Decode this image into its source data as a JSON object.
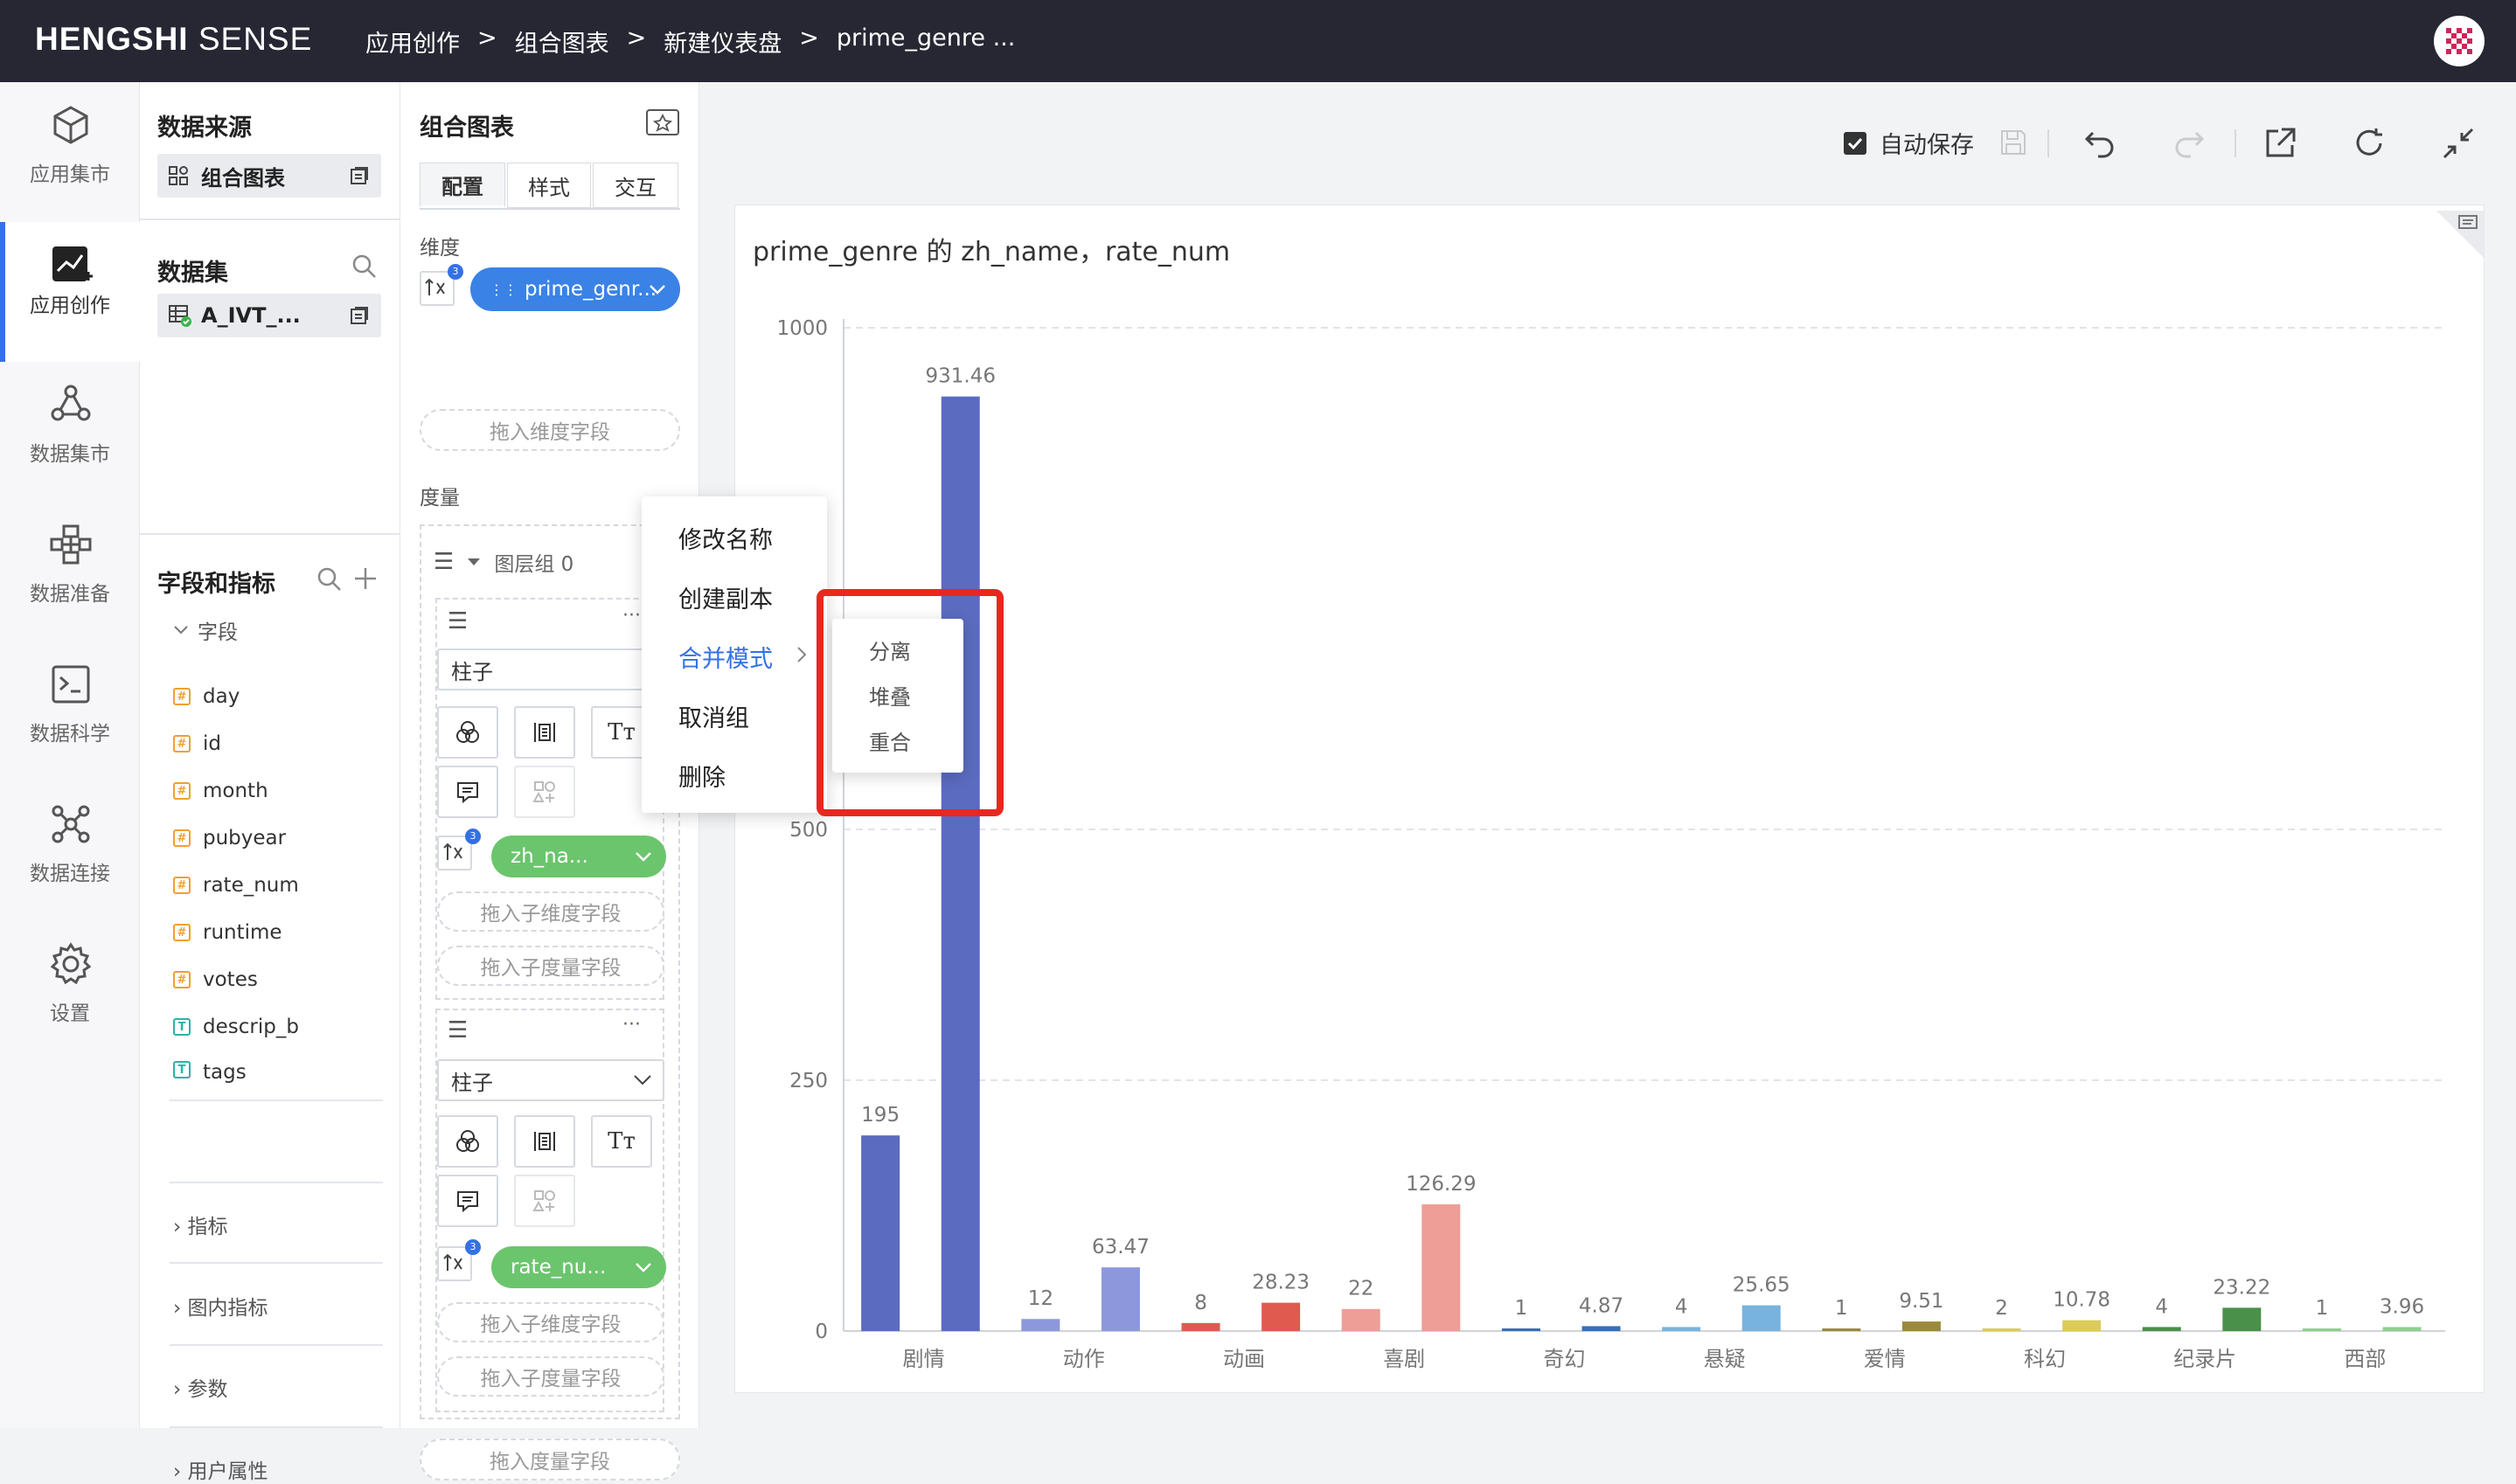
{
  "app": {
    "logo_bold": "HENGSHI",
    "logo_light": " SENSE",
    "breadcrumb": [
      "应用创作",
      "组合图表",
      "新建仪表盘",
      "prime_genre ..."
    ],
    "breadcrumb_sep": ">"
  },
  "nav": {
    "items": [
      {
        "label": "应用集市",
        "icon": "cube-icon"
      },
      {
        "label": "应用创作",
        "icon": "chart-edit-icon"
      },
      {
        "label": "数据集市",
        "icon": "dataset-market-icon"
      },
      {
        "label": "数据准备",
        "icon": "data-prep-icon"
      },
      {
        "label": "数据科学",
        "icon": "terminal-icon"
      },
      {
        "label": "数据连接",
        "icon": "connection-icon"
      },
      {
        "label": "设置",
        "icon": "gear-icon"
      }
    ]
  },
  "datasource": {
    "title": "数据来源",
    "item": "组合图表"
  },
  "dataset": {
    "title": "数据集",
    "item": "A_IVT_..."
  },
  "fields": {
    "title": "字段和指标",
    "group_label": "字段",
    "items": [
      {
        "name": "day",
        "type": "#"
      },
      {
        "name": "id",
        "type": "#"
      },
      {
        "name": "month",
        "type": "#"
      },
      {
        "name": "pubyear",
        "type": "#"
      },
      {
        "name": "rate_num",
        "type": "#"
      },
      {
        "name": "runtime",
        "type": "#"
      },
      {
        "name": "votes",
        "type": "#"
      },
      {
        "name": "descrip_b",
        "type": "T"
      },
      {
        "name": "tags",
        "type": "T"
      }
    ],
    "sections": [
      "指标",
      "图内指标",
      "参数",
      "用户属性"
    ]
  },
  "config": {
    "title": "组合图表",
    "tabs": [
      "配置",
      "样式",
      "交互"
    ],
    "dimension_label": "维度",
    "dimension_pill": "prime_genr...",
    "dimension_placeholder": "拖入维度字段",
    "measure_label": "度量",
    "layer_group": "图层组 0",
    "layer1_type": "柱子",
    "layer1_pill": "zh_na...",
    "layer2_type": "柱子",
    "layer2_pill": "rate_nu...",
    "sub_dim_placeholder": "拖入子维度字段",
    "sub_measure_placeholder": "拖入子度量字段",
    "measure_placeholder": "拖入度量字段",
    "badge": "3"
  },
  "context_menu": {
    "items": [
      "修改名称",
      "创建副本",
      "合并模式",
      "取消组",
      "删除"
    ],
    "submenu": [
      "分离",
      "堆叠",
      "重合"
    ]
  },
  "toolbar": {
    "autosave_label": "自动保存",
    "autosave_checked": true
  },
  "chart_data": {
    "type": "bar",
    "title": "prime_genre 的 zh_name，rate_num",
    "ylim": [
      0,
      1000
    ],
    "yticks": [
      0,
      250,
      500,
      1000
    ],
    "categories": [
      "剧情",
      "动作",
      "动画",
      "喜剧",
      "奇幻",
      "悬疑",
      "爱情",
      "科幻",
      "纪录片",
      "西部"
    ],
    "series": [
      {
        "values": [
          195,
          12,
          8,
          22,
          1,
          4,
          1,
          2,
          4,
          1
        ]
      },
      {
        "values": [
          931.46,
          63.47,
          28.23,
          126.29,
          4.87,
          25.65,
          9.51,
          10.78,
          23.22,
          3.96
        ]
      }
    ],
    "colors_a": [
      "#5b6bbf",
      "#8d98dc",
      "#e05a4f",
      "#ee9e97",
      "#3470b8",
      "#78b3e0",
      "#9a8a3c",
      "#dccb58",
      "#4a8f4a",
      "#8fcf8f"
    ],
    "colors_b": [
      "#5b6bbf",
      "#8d98dc",
      "#e05a4f",
      "#ee9e97",
      "#3470b8",
      "#78b3e0",
      "#9a8a3c",
      "#dccb58",
      "#4a8f4a",
      "#8fcf8f"
    ],
    "grid": true
  }
}
